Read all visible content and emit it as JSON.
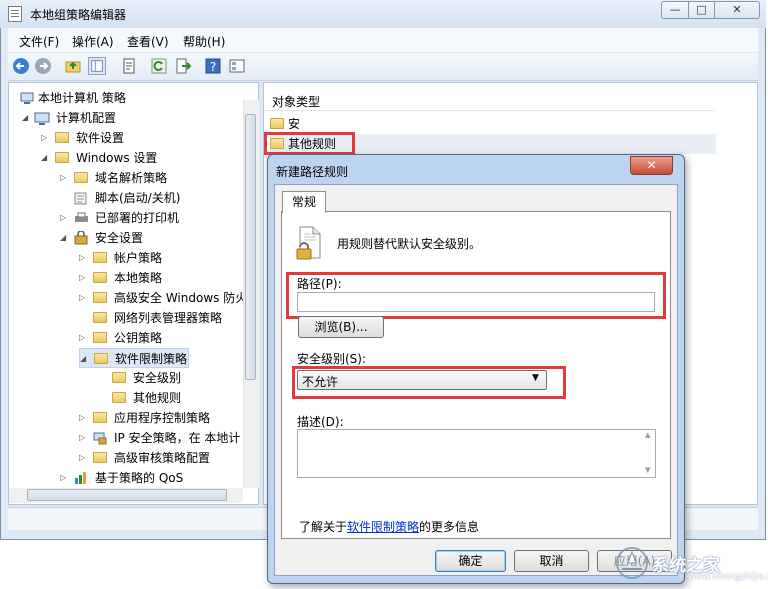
{
  "window": {
    "title": "本地组策略编辑器",
    "min_glyph": "—",
    "max_glyph": "□",
    "close_glyph": "✕"
  },
  "menu": [
    "文件(F)",
    "操作(A)",
    "查看(V)",
    "帮助(H)"
  ],
  "toolbar_icons": [
    "back-icon",
    "forward-icon",
    "up-folder-icon",
    "show-tree-icon",
    "properties-icon",
    "refresh-icon",
    "export-icon",
    "help-icon",
    "filter-icon"
  ],
  "tree": {
    "root": "本地计算机 策略",
    "computer_config": "计算机配置",
    "software_settings": "软件设置",
    "windows_settings": "Windows 设置",
    "dns_policy": "域名解析策略",
    "scripts": "脚本(启动/关机)",
    "printers": "已部署的打印机",
    "security_settings": "安全设置",
    "account_policy": "帐户策略",
    "local_policy": "本地策略",
    "firewall": "高级安全 Windows 防火",
    "network_list": "网络列表管理器策略",
    "public_key": "公钥策略",
    "srp": "软件限制策略",
    "security_levels": "安全级别",
    "other_rules": "其他规则",
    "app_control": "应用程序控制策略",
    "ip_security": "IP 安全策略，在 本地计",
    "audit_config": "高级审核策略配置",
    "qos": "基于策略的 QoS"
  },
  "right_pane": {
    "header": "对象类型",
    "items": [
      "安全级别",
      "其他规则"
    ]
  },
  "dialog": {
    "title": "新建路径规则",
    "close_glyph": "✕",
    "tab": "常规",
    "description_text": "用规则替代默认安全级别。",
    "path_label": "路径(P):",
    "path_value": "",
    "browse_button": "浏览(B)...",
    "security_level_label": "安全级别(S):",
    "security_level_value": "不允许",
    "desc_label": "描述(D):",
    "desc_value": "",
    "info_prefix": "了解关于",
    "info_link": "软件限制策略",
    "info_suffix": "的更多信息",
    "ok_button": "确定",
    "cancel_button": "取消",
    "apply_button": "应用(A)"
  },
  "watermark": {
    "text": "系统之家",
    "url": "www.xitongzhijia.net"
  },
  "colors": {
    "highlight_red": "#e13b3b",
    "dialog_frame": "#bcd4ee",
    "link": "#0033cc"
  }
}
